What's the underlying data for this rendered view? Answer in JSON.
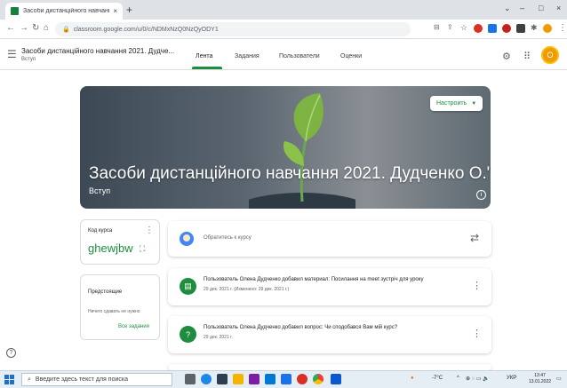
{
  "browser": {
    "tab_title": "Засоби дистанційного навчанн",
    "tab_close": "×",
    "new_tab": "+",
    "url": "classroom.google.com/u/0/c/NDMxNzQ0NzQyODY1",
    "window_controls": [
      "⌄",
      "–",
      "□",
      "×"
    ]
  },
  "header": {
    "class_title": "Засоби дистанційного навчання 2021. Дудче...",
    "class_subtitle": "Вступ",
    "tabs": [
      "Лента",
      "Задания",
      "Пользователи",
      "Оценки"
    ],
    "active_tab": "Лента",
    "avatar_letter": "О"
  },
  "banner": {
    "title": "Засоби дистанційного навчання 2021. Дудченко О.\"",
    "subtitle": "Вступ",
    "customize_label": "Настроить",
    "info_icon": "i"
  },
  "class_code": {
    "label": "Код курса",
    "value": "ghewjbw"
  },
  "upcoming": {
    "title": "Предстоящие",
    "text": "Ничего сдавать не нужно",
    "link": "Все задания"
  },
  "stream": {
    "share_placeholder": "Обратитесь к курсу",
    "posts": [
      {
        "title": "Пользователь Олена Дудченко добавил материал: Посилання на meet зустріч для уроку",
        "date": "29 дек. 2021 г. (Изменено: 29 дек. 2021 г.)",
        "icon": "material-icon"
      },
      {
        "title": "Пользователь Олена Дудченко добавил вопрос: Чи сподобався Вам мій курс?",
        "date": "29 дек. 2021 г.",
        "icon": "question-icon"
      }
    ]
  },
  "taskbar": {
    "search_placeholder": "Введите здесь текст для поиска",
    "temperature": "-7°C",
    "language": "УКР",
    "time": "13:47",
    "date": "13.01.2022"
  },
  "colors": {
    "accent": "#1e8e3e",
    "avatar": "#f29900"
  }
}
